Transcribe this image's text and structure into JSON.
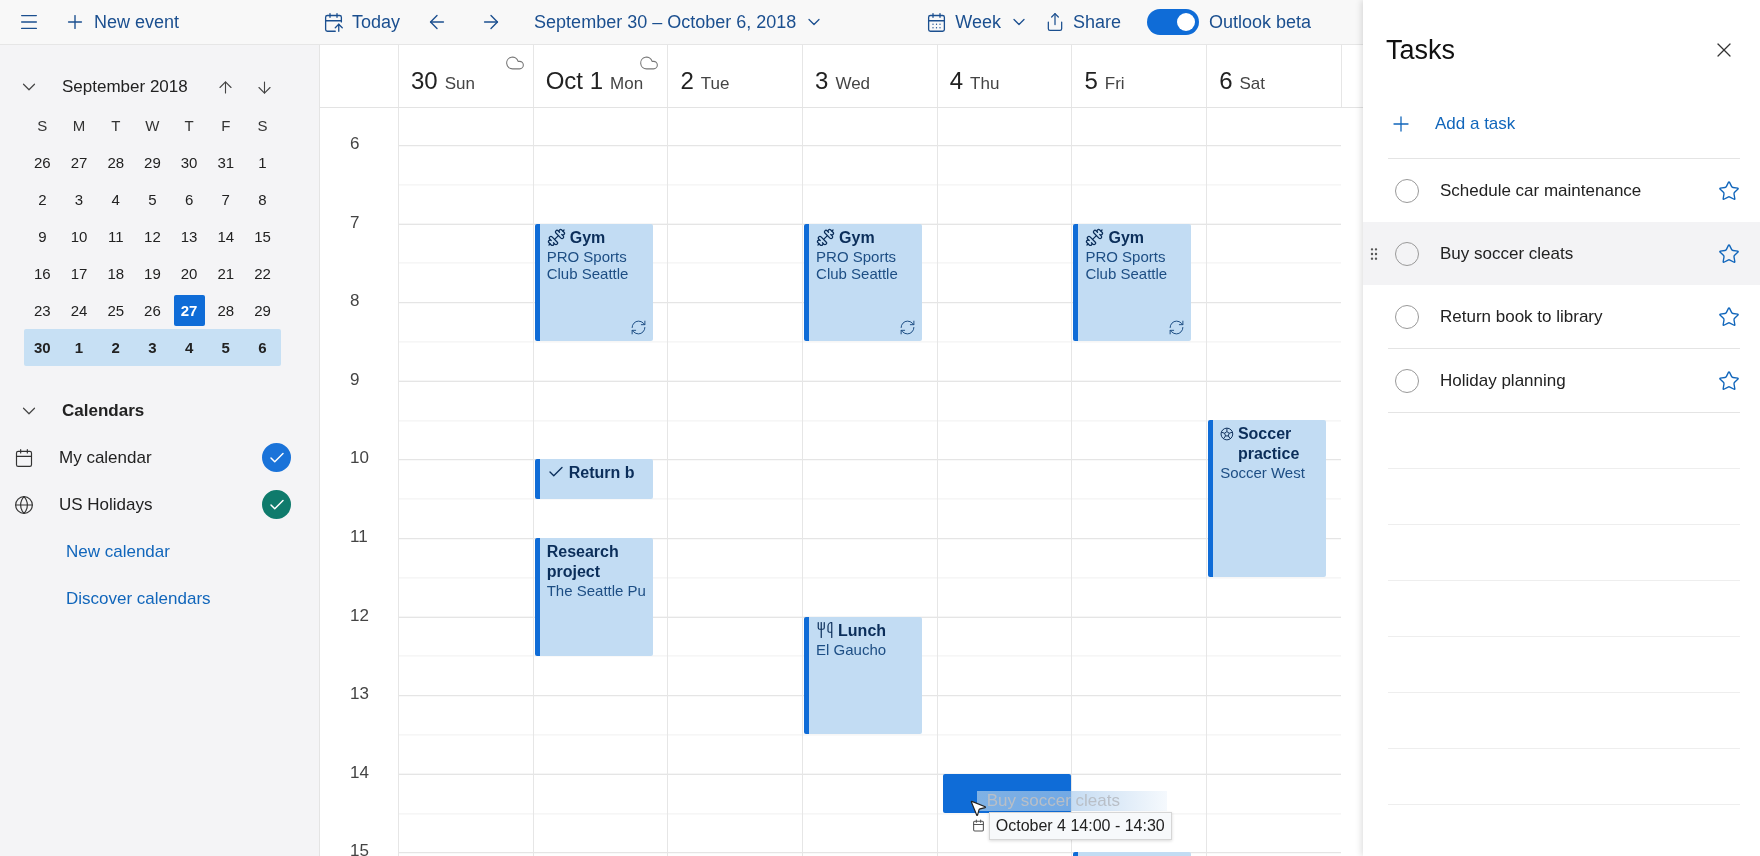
{
  "toolbar": {
    "new_event": "New event",
    "today": "Today",
    "date_range": "September 30 – October 6, 2018",
    "view": "Week",
    "share": "Share",
    "beta_toggle": {
      "label": "Outlook beta",
      "on": true
    }
  },
  "mini_calendar": {
    "title": "September 2018",
    "weekdays": [
      "S",
      "M",
      "T",
      "W",
      "T",
      "F",
      "S"
    ],
    "weeks": [
      {
        "selected": false,
        "days": [
          {
            "label": "26",
            "today": false
          },
          {
            "label": "27",
            "today": false
          },
          {
            "label": "28",
            "today": false
          },
          {
            "label": "29",
            "today": false
          },
          {
            "label": "30",
            "today": false
          },
          {
            "label": "31",
            "today": false
          },
          {
            "label": "1",
            "today": false
          }
        ]
      },
      {
        "selected": false,
        "days": [
          {
            "label": "2",
            "today": false
          },
          {
            "label": "3",
            "today": false
          },
          {
            "label": "4",
            "today": false
          },
          {
            "label": "5",
            "today": false
          },
          {
            "label": "6",
            "today": false
          },
          {
            "label": "7",
            "today": false
          },
          {
            "label": "8",
            "today": false
          }
        ]
      },
      {
        "selected": false,
        "days": [
          {
            "label": "9",
            "today": false
          },
          {
            "label": "10",
            "today": false
          },
          {
            "label": "11",
            "today": false
          },
          {
            "label": "12",
            "today": false
          },
          {
            "label": "13",
            "today": false
          },
          {
            "label": "14",
            "today": false
          },
          {
            "label": "15",
            "today": false
          }
        ]
      },
      {
        "selected": false,
        "days": [
          {
            "label": "16",
            "today": false
          },
          {
            "label": "17",
            "today": false
          },
          {
            "label": "18",
            "today": false
          },
          {
            "label": "19",
            "today": false
          },
          {
            "label": "20",
            "today": false
          },
          {
            "label": "21",
            "today": false
          },
          {
            "label": "22",
            "today": false
          }
        ]
      },
      {
        "selected": false,
        "days": [
          {
            "label": "23",
            "today": false
          },
          {
            "label": "24",
            "today": false
          },
          {
            "label": "25",
            "today": false
          },
          {
            "label": "26",
            "today": false
          },
          {
            "label": "27",
            "today": true
          },
          {
            "label": "28",
            "today": false
          },
          {
            "label": "29",
            "today": false
          }
        ]
      },
      {
        "selected": true,
        "days": [
          {
            "label": "30",
            "today": false
          },
          {
            "label": "1",
            "today": false
          },
          {
            "label": "2",
            "today": false
          },
          {
            "label": "3",
            "today": false
          },
          {
            "label": "4",
            "today": false
          },
          {
            "label": "5",
            "today": false
          },
          {
            "label": "6",
            "today": false
          }
        ]
      }
    ]
  },
  "calendars": {
    "title": "Calendars",
    "expanded": true,
    "items": [
      {
        "kind": "personal",
        "name": "My calendar",
        "checked": true,
        "color": "#1a73d9"
      },
      {
        "kind": "holidays",
        "name": "US Holidays",
        "checked": true,
        "color": "#0f7b6c"
      }
    ],
    "links": [
      "New calendar",
      "Discover calendars"
    ]
  },
  "days": [
    {
      "number": "30",
      "name": "Sun",
      "cloud": true
    },
    {
      "number": "Oct 1",
      "name": "Mon",
      "cloud": true
    },
    {
      "number": "2",
      "name": "Tue"
    },
    {
      "number": "3",
      "name": "Wed"
    },
    {
      "number": "4",
      "name": "Thu"
    },
    {
      "number": "5",
      "name": "Fri"
    },
    {
      "number": "6",
      "name": "Sat"
    }
  ],
  "hours": [
    "6",
    "7",
    "8",
    "9",
    "10",
    "11",
    "12",
    "13",
    "14",
    "15"
  ],
  "events": [
    {
      "kind": "workout",
      "title": "Gym",
      "location": "PRO Sports Club Seattle",
      "recurring": true
    },
    {
      "kind": "workout",
      "title": "Gym",
      "location": "PRO Sports Club Seattle",
      "recurring": true
    },
    {
      "kind": "workout",
      "title": "Gym",
      "location": "PRO Sports Club Seattle",
      "recurring": true
    },
    {
      "kind": "task",
      "title": "Return b"
    },
    {
      "kind": "plain",
      "title": "Research project",
      "location": "The Seattle Pu"
    },
    {
      "kind": "meal",
      "title": "Lunch",
      "location": "El Gaucho"
    },
    {
      "kind": "sport",
      "title": "Soccer practice",
      "location": "Soccer West"
    },
    {
      "kind": "plain"
    }
  ],
  "drag": {
    "ghost_text": "Buy soccer cleats",
    "tooltip": "October 4 14:00 - 14:30"
  },
  "tasks_panel": {
    "title": "Tasks",
    "add_label": "Add a task",
    "tasks": [
      {
        "title": "Schedule car maintenance",
        "completed": false,
        "starred": false,
        "hovered": false
      },
      {
        "title": "Buy soccer cleats",
        "completed": false,
        "starred": false,
        "hovered": true
      },
      {
        "title": "Return book to library",
        "completed": false,
        "starred": false,
        "hovered": false
      },
      {
        "title": "Holiday planning",
        "completed": false,
        "starred": false,
        "hovered": false
      }
    ]
  }
}
